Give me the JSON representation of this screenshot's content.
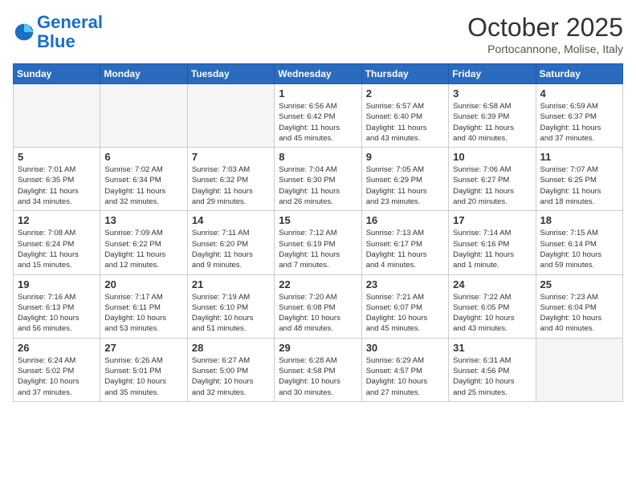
{
  "header": {
    "logo_line1": "General",
    "logo_line2": "Blue",
    "month": "October 2025",
    "location": "Portocannone, Molise, Italy"
  },
  "weekdays": [
    "Sunday",
    "Monday",
    "Tuesday",
    "Wednesday",
    "Thursday",
    "Friday",
    "Saturday"
  ],
  "weeks": [
    [
      {
        "day": "",
        "info": ""
      },
      {
        "day": "",
        "info": ""
      },
      {
        "day": "",
        "info": ""
      },
      {
        "day": "1",
        "info": "Sunrise: 6:56 AM\nSunset: 6:42 PM\nDaylight: 11 hours\nand 45 minutes."
      },
      {
        "day": "2",
        "info": "Sunrise: 6:57 AM\nSunset: 6:40 PM\nDaylight: 11 hours\nand 43 minutes."
      },
      {
        "day": "3",
        "info": "Sunrise: 6:58 AM\nSunset: 6:39 PM\nDaylight: 11 hours\nand 40 minutes."
      },
      {
        "day": "4",
        "info": "Sunrise: 6:59 AM\nSunset: 6:37 PM\nDaylight: 11 hours\nand 37 minutes."
      }
    ],
    [
      {
        "day": "5",
        "info": "Sunrise: 7:01 AM\nSunset: 6:35 PM\nDaylight: 11 hours\nand 34 minutes."
      },
      {
        "day": "6",
        "info": "Sunrise: 7:02 AM\nSunset: 6:34 PM\nDaylight: 11 hours\nand 32 minutes."
      },
      {
        "day": "7",
        "info": "Sunrise: 7:03 AM\nSunset: 6:32 PM\nDaylight: 11 hours\nand 29 minutes."
      },
      {
        "day": "8",
        "info": "Sunrise: 7:04 AM\nSunset: 6:30 PM\nDaylight: 11 hours\nand 26 minutes."
      },
      {
        "day": "9",
        "info": "Sunrise: 7:05 AM\nSunset: 6:29 PM\nDaylight: 11 hours\nand 23 minutes."
      },
      {
        "day": "10",
        "info": "Sunrise: 7:06 AM\nSunset: 6:27 PM\nDaylight: 11 hours\nand 20 minutes."
      },
      {
        "day": "11",
        "info": "Sunrise: 7:07 AM\nSunset: 6:25 PM\nDaylight: 11 hours\nand 18 minutes."
      }
    ],
    [
      {
        "day": "12",
        "info": "Sunrise: 7:08 AM\nSunset: 6:24 PM\nDaylight: 11 hours\nand 15 minutes."
      },
      {
        "day": "13",
        "info": "Sunrise: 7:09 AM\nSunset: 6:22 PM\nDaylight: 11 hours\nand 12 minutes."
      },
      {
        "day": "14",
        "info": "Sunrise: 7:11 AM\nSunset: 6:20 PM\nDaylight: 11 hours\nand 9 minutes."
      },
      {
        "day": "15",
        "info": "Sunrise: 7:12 AM\nSunset: 6:19 PM\nDaylight: 11 hours\nand 7 minutes."
      },
      {
        "day": "16",
        "info": "Sunrise: 7:13 AM\nSunset: 6:17 PM\nDaylight: 11 hours\nand 4 minutes."
      },
      {
        "day": "17",
        "info": "Sunrise: 7:14 AM\nSunset: 6:16 PM\nDaylight: 11 hours\nand 1 minute."
      },
      {
        "day": "18",
        "info": "Sunrise: 7:15 AM\nSunset: 6:14 PM\nDaylight: 10 hours\nand 59 minutes."
      }
    ],
    [
      {
        "day": "19",
        "info": "Sunrise: 7:16 AM\nSunset: 6:13 PM\nDaylight: 10 hours\nand 56 minutes."
      },
      {
        "day": "20",
        "info": "Sunrise: 7:17 AM\nSunset: 6:11 PM\nDaylight: 10 hours\nand 53 minutes."
      },
      {
        "day": "21",
        "info": "Sunrise: 7:19 AM\nSunset: 6:10 PM\nDaylight: 10 hours\nand 51 minutes."
      },
      {
        "day": "22",
        "info": "Sunrise: 7:20 AM\nSunset: 6:08 PM\nDaylight: 10 hours\nand 48 minutes."
      },
      {
        "day": "23",
        "info": "Sunrise: 7:21 AM\nSunset: 6:07 PM\nDaylight: 10 hours\nand 45 minutes."
      },
      {
        "day": "24",
        "info": "Sunrise: 7:22 AM\nSunset: 6:05 PM\nDaylight: 10 hours\nand 43 minutes."
      },
      {
        "day": "25",
        "info": "Sunrise: 7:23 AM\nSunset: 6:04 PM\nDaylight: 10 hours\nand 40 minutes."
      }
    ],
    [
      {
        "day": "26",
        "info": "Sunrise: 6:24 AM\nSunset: 5:02 PM\nDaylight: 10 hours\nand 37 minutes."
      },
      {
        "day": "27",
        "info": "Sunrise: 6:26 AM\nSunset: 5:01 PM\nDaylight: 10 hours\nand 35 minutes."
      },
      {
        "day": "28",
        "info": "Sunrise: 6:27 AM\nSunset: 5:00 PM\nDaylight: 10 hours\nand 32 minutes."
      },
      {
        "day": "29",
        "info": "Sunrise: 6:28 AM\nSunset: 4:58 PM\nDaylight: 10 hours\nand 30 minutes."
      },
      {
        "day": "30",
        "info": "Sunrise: 6:29 AM\nSunset: 4:57 PM\nDaylight: 10 hours\nand 27 minutes."
      },
      {
        "day": "31",
        "info": "Sunrise: 6:31 AM\nSunset: 4:56 PM\nDaylight: 10 hours\nand 25 minutes."
      },
      {
        "day": "",
        "info": ""
      }
    ]
  ]
}
